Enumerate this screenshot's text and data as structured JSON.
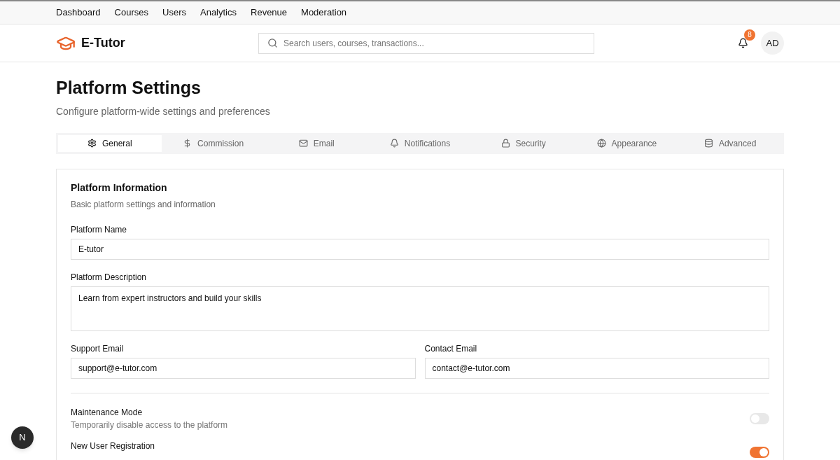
{
  "top_nav": [
    {
      "label": "Dashboard"
    },
    {
      "label": "Courses"
    },
    {
      "label": "Users"
    },
    {
      "label": "Analytics"
    },
    {
      "label": "Revenue"
    },
    {
      "label": "Moderation"
    }
  ],
  "header": {
    "brand": "E-Tutor",
    "search": {
      "placeholder": "Search users, courses, transactions..."
    },
    "notification_count": "8",
    "avatar": "AD"
  },
  "page": {
    "title": "Platform Settings",
    "subtitle": "Configure platform-wide settings and preferences"
  },
  "tabs": [
    {
      "label": "General",
      "selected": true
    },
    {
      "label": "Commission",
      "selected": false
    },
    {
      "label": "Email",
      "selected": false
    },
    {
      "label": "Notifications",
      "selected": false
    },
    {
      "label": "Security",
      "selected": false
    },
    {
      "label": "Appearance",
      "selected": false
    },
    {
      "label": "Advanced",
      "selected": false
    }
  ],
  "card": {
    "title": "Platform Information",
    "subtitle": "Basic platform settings and information",
    "fields": [
      {
        "kind": "input",
        "label": "Platform Name",
        "value": "E-tutor"
      },
      {
        "kind": "textarea",
        "label": "Platform Description",
        "value": "Learn from expert instructors and build your skills"
      }
    ],
    "email_fields": [
      {
        "label": "Support Email",
        "value": "support@e-tutor.com"
      },
      {
        "label": "Contact Email",
        "value": "contact@e-tutor.com"
      }
    ],
    "toggles": [
      {
        "label": "Maintenance Mode",
        "description": "Temporarily disable access to the platform",
        "on": false
      },
      {
        "label": "New User Registration",
        "on": true
      }
    ]
  },
  "dev_badge": "N"
}
